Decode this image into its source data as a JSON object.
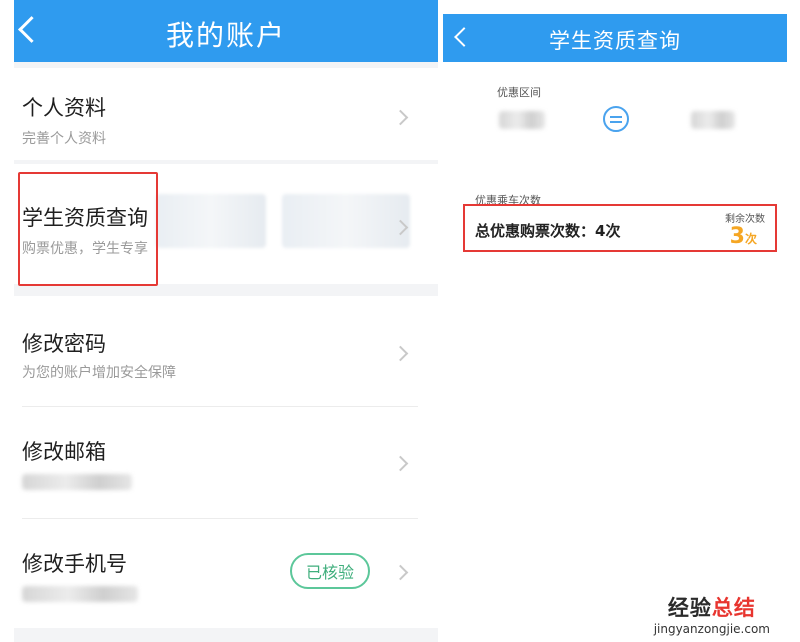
{
  "left": {
    "header": {
      "title": "我的账户"
    },
    "items": [
      {
        "title": "个人资料",
        "subtitle": "完善个人资料"
      },
      {
        "title": "学生资质查询",
        "subtitle": "购票优惠，学生专享"
      },
      {
        "title": "修改密码",
        "subtitle": "为您的账户增加安全保障"
      },
      {
        "title": "修改邮箱"
      },
      {
        "title": "修改手机号",
        "badge": "已核验"
      }
    ]
  },
  "right": {
    "header": {
      "title": "学生资质查询"
    },
    "discount_range_label": "优惠区间",
    "ride_count_label": "优惠乘车次数",
    "total_label": "总优惠购票次数：4次",
    "remaining_label": "剩余次数",
    "remaining_value": "3",
    "remaining_unit": "次"
  },
  "watermark": {
    "brand_a": "经验",
    "brand_b": "总结",
    "site": "jingyanzongjie.com"
  },
  "colors": {
    "header_blue": "#2f9bef",
    "highlight_red": "#e53935",
    "verified_green": "#5cc79a",
    "remaining_orange": "#f5a623"
  }
}
